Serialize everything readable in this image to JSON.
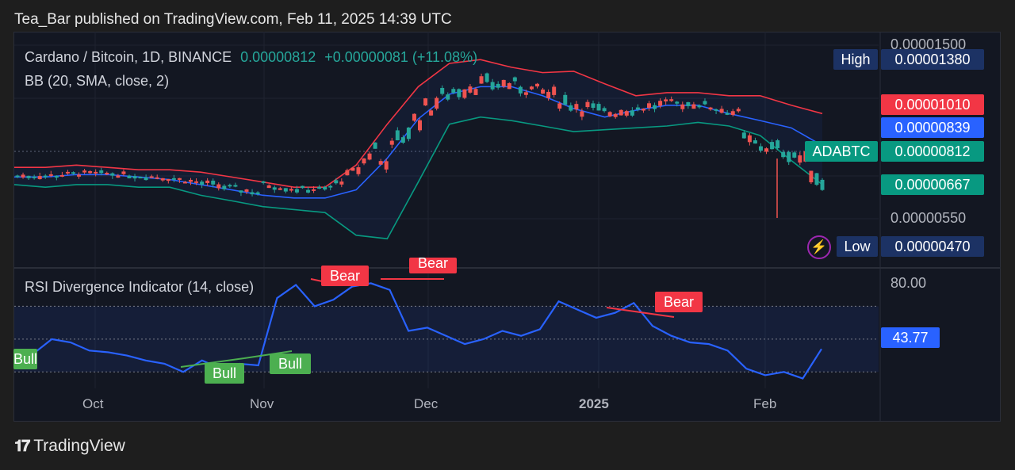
{
  "header": {
    "published": "Tea_Bar published on TradingView.com, Feb 11, 2025 14:39 UTC"
  },
  "legend": {
    "symbol": "Cardano / Bitcoin, 1D, BINANCE",
    "price": "0.00000812",
    "change": "+0.00000081 (+11.08%)",
    "indicator": "BB (20, SMA, close, 2)",
    "rsi_title": "RSI Divergence Indicator (14, close)"
  },
  "price_axis": {
    "ticks": [
      "0.00001500",
      "0.00000550"
    ],
    "high_label": "High",
    "high_value": "0.00001380",
    "low_label": "Low",
    "low_value": "0.00000470",
    "bb_upper": "0.00001010",
    "bb_basis": "0.00000839",
    "symbol_tag": "ADABTC",
    "last_price": "0.00000812",
    "bb_lower": "0.00000667"
  },
  "rsi_axis": {
    "tick": "80.00",
    "value": "43.77"
  },
  "time_axis": [
    "Oct",
    "Nov",
    "Dec",
    "2025",
    "Feb"
  ],
  "divergence_labels": [
    {
      "text": "Bull",
      "type": "bull"
    },
    {
      "text": "Bull",
      "type": "bull"
    },
    {
      "text": "Bull",
      "type": "bull"
    },
    {
      "text": "Bear",
      "type": "bear"
    },
    {
      "text": "Bear",
      "type": "bear"
    },
    {
      "text": "Bear",
      "type": "bear"
    }
  ],
  "footer": {
    "brand": "TradingView"
  },
  "colors": {
    "up": "#26a69a",
    "down": "#ef5350",
    "bb_upper": "#f23645",
    "bb_basis": "#2962ff",
    "bb_lower": "#089981",
    "rsi": "#2962ff",
    "bull": "#4caf50",
    "bear": "#f23645"
  },
  "chart_data": [
    {
      "type": "candlestick",
      "title": "Cardano / Bitcoin, 1D, BINANCE",
      "x_range": [
        "2024-09-18",
        "2025-02-11"
      ],
      "ylim": [
        4.7e-06,
        1.5e-05
      ],
      "y_scale": "log",
      "last_close": 8.12e-06,
      "high": 1.38e-05,
      "low": 4.7e-06,
      "series": [
        {
          "name": "BB Upper",
          "values": [
            7.4e-06,
            7.4e-06,
            7.5e-06,
            7.4e-06,
            7.3e-06,
            7.3e-06,
            7.2e-06,
            7e-06,
            6.8e-06,
            6.6e-06,
            6.6e-06,
            7.5e-06,
            9.5e-06,
            1.18e-05,
            1.35e-05,
            1.38e-05,
            1.32e-05,
            1.28e-05,
            1.29e-05,
            1.2e-05,
            1.12e-05,
            1.14e-05,
            1.14e-05,
            1.12e-05,
            1.12e-05,
            1.06e-05,
            1.01e-05
          ]
        },
        {
          "name": "BB Basis",
          "values": [
            7e-06,
            7e-06,
            7.1e-06,
            7.1e-06,
            7e-06,
            6.9e-06,
            6.7e-06,
            6.5e-06,
            6.3e-06,
            6.2e-06,
            6.2e-06,
            6.5e-06,
            7.8e-06,
            9.8e-06,
            1.13e-05,
            1.18e-05,
            1.18e-05,
            1.12e-05,
            1.04e-05,
            9.9e-06,
            1.03e-05,
            1.06e-05,
            1.06e-05,
            1.01e-05,
            9.7e-06,
            9.3e-06,
            8.4e-06
          ]
        },
        {
          "name": "BB Lower",
          "values": [
            6.7e-06,
            6.6e-06,
            6.7e-06,
            6.7e-06,
            6.6e-06,
            6.6e-06,
            6.3e-06,
            6.1e-06,
            5.9e-06,
            5.8e-06,
            5.7e-06,
            5e-06,
            4.8e-06,
            6.8e-06,
            9.5e-06,
            9.9e-06,
            9.7e-06,
            9.4e-06,
            9.1e-06,
            9.2e-06,
            9.3e-06,
            9.4e-06,
            9.6e-06,
            9.4e-06,
            8.9e-06,
            7.7e-06,
            6.7e-06
          ]
        }
      ]
    },
    {
      "type": "line",
      "title": "RSI Divergence Indicator (14, close)",
      "ylim": [
        20,
        90
      ],
      "levels": [
        70,
        50,
        30
      ],
      "series": [
        {
          "name": "RSI",
          "values": [
            38,
            41,
            50,
            48,
            43,
            42,
            40,
            37,
            35,
            30,
            37,
            32,
            35,
            34,
            75,
            83,
            70,
            74,
            82,
            84,
            80,
            55,
            57,
            52,
            47,
            50,
            55,
            52,
            56,
            73,
            68,
            63,
            66,
            72,
            58,
            52,
            48,
            47,
            43,
            32,
            28,
            30,
            26,
            44
          ]
        }
      ]
    }
  ]
}
